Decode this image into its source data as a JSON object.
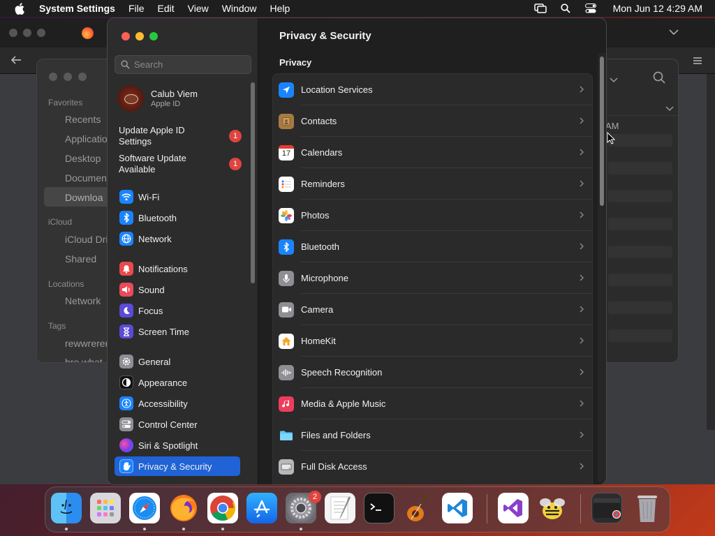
{
  "menubar": {
    "app_name": "System Settings",
    "menus": [
      "File",
      "Edit",
      "View",
      "Window",
      "Help"
    ],
    "clock": "Mon Jun 12  4:29 AM"
  },
  "finder": {
    "sections": [
      {
        "header": "Favorites",
        "items": [
          "Recents",
          "Applicatio",
          "Desktop",
          "Documen",
          "Downloa"
        ]
      },
      {
        "header": "iCloud",
        "items": [
          "iCloud Dri",
          "Shared"
        ]
      },
      {
        "header": "Locations",
        "items": [
          "Network"
        ]
      },
      {
        "header": "Tags",
        "items": [
          "rewwrerer",
          "bro what"
        ]
      }
    ],
    "partial_text": "AM"
  },
  "settings": {
    "search_placeholder": "Search",
    "account": {
      "name": "Calub Viem",
      "subtitle": "Apple ID"
    },
    "notices": [
      {
        "label": "Update Apple ID Settings",
        "badge": "1"
      },
      {
        "label": "Software Update Available",
        "badge": "1"
      }
    ],
    "nav_groups": [
      [
        {
          "label": "Wi-Fi",
          "icon": "wifi-icon",
          "color": "#1a84ff"
        },
        {
          "label": "Bluetooth",
          "icon": "bluetooth-icon",
          "color": "#1a84ff"
        },
        {
          "label": "Network",
          "icon": "globe-icon",
          "color": "#1a84ff"
        }
      ],
      [
        {
          "label": "Notifications",
          "icon": "bell-icon",
          "color": "#ea4a4a"
        },
        {
          "label": "Sound",
          "icon": "speaker-icon",
          "color": "#ea4a5a"
        },
        {
          "label": "Focus",
          "icon": "moon-icon",
          "color": "#5b4bd6"
        },
        {
          "label": "Screen Time",
          "icon": "hourglass-icon",
          "color": "#5b4bd6"
        }
      ],
      [
        {
          "label": "General",
          "icon": "gear-icon",
          "color": "#8e8e93"
        },
        {
          "label": "Appearance",
          "icon": "appearance-icon",
          "color": "#111111"
        },
        {
          "label": "Accessibility",
          "icon": "accessibility-icon",
          "color": "#1a84ff"
        },
        {
          "label": "Control Center",
          "icon": "switches-icon",
          "color": "#8e8e93"
        },
        {
          "label": "Siri & Spotlight",
          "icon": "siri-icon",
          "color": "#b03cc8"
        },
        {
          "label": "Privacy & Security",
          "icon": "hand-icon",
          "color": "#1a84ff",
          "selected": true
        }
      ]
    ],
    "main": {
      "title": "Privacy & Security",
      "section": "Privacy",
      "rows": [
        {
          "label": "Location Services",
          "icon": "location-arrow-icon",
          "color": "#1a84ff"
        },
        {
          "label": "Contacts",
          "icon": "contacts-icon",
          "color": "#a77a42"
        },
        {
          "label": "Calendars",
          "icon": "calendar-icon",
          "color": "#ffffff",
          "icon_text": "17"
        },
        {
          "label": "Reminders",
          "icon": "reminders-icon",
          "color": "#ffffff"
        },
        {
          "label": "Photos",
          "icon": "photos-icon",
          "color": "#ffffff"
        },
        {
          "label": "Bluetooth",
          "icon": "bluetooth-icon",
          "color": "#1a84ff"
        },
        {
          "label": "Microphone",
          "icon": "microphone-icon",
          "color": "#8e8e93"
        },
        {
          "label": "Camera",
          "icon": "camera-icon",
          "color": "#8e8e93"
        },
        {
          "label": "HomeKit",
          "icon": "home-icon",
          "color": "#ffffff"
        },
        {
          "label": "Speech Recognition",
          "icon": "waveform-icon",
          "color": "#8e8e93"
        },
        {
          "label": "Media & Apple Music",
          "icon": "music-note-icon",
          "color": "#ee3d5b"
        },
        {
          "label": "Files and Folders",
          "icon": "folder-icon",
          "color": "#5ac8fa"
        },
        {
          "label": "Full Disk Access",
          "icon": "disk-icon",
          "color": "#8e8e93"
        }
      ]
    }
  },
  "dock": {
    "apps": [
      {
        "name": "finder-icon",
        "running": true
      },
      {
        "name": "launchpad-icon",
        "running": false
      },
      {
        "name": "safari-icon",
        "running": true
      },
      {
        "name": "firefox-icon",
        "running": true
      },
      {
        "name": "chrome-icon",
        "running": true
      },
      {
        "name": "app-store-icon",
        "running": false
      },
      {
        "name": "system-settings-icon",
        "running": true,
        "badge": "2"
      },
      {
        "name": "textedit-icon",
        "running": false
      },
      {
        "name": "terminal-icon",
        "running": false
      },
      {
        "name": "garageband-icon",
        "running": false
      },
      {
        "name": "vscode-icon",
        "running": false
      },
      {
        "name": "visual-studio-icon",
        "running": false
      },
      {
        "name": "cyberduck-icon",
        "running": false
      },
      {
        "name": "minimized-window-icon",
        "running": false
      },
      {
        "name": "trash-icon",
        "running": false
      }
    ]
  }
}
